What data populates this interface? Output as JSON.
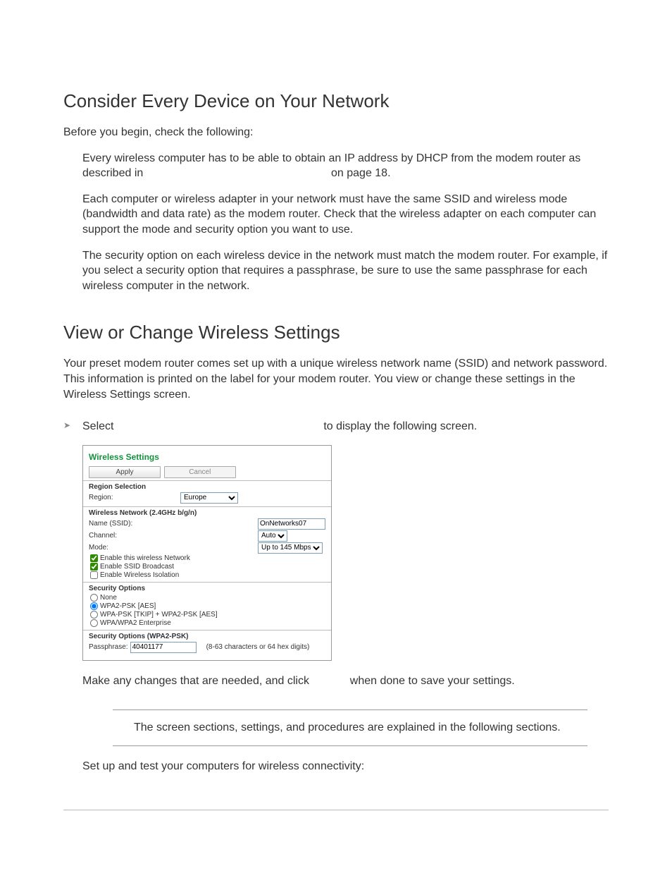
{
  "h1": "Consider Every Device on Your Network",
  "p1": "Before you begin, check the following:",
  "bullet1_a": "Every wireless computer has to be able to obtain an IP address by DHCP from the modem router as described in",
  "bullet1_b": "on page 18.",
  "bullet2": "Each computer or wireless adapter in your network must have the same SSID and wireless mode (bandwidth and data rate) as the modem router. Check that the wireless adapter on each computer can support the mode and security option you want to use.",
  "bullet3": "The security option on each wireless device in the network must match the modem router. For example, if you select a security option that requires a passphrase, be sure to use the same passphrase for each wireless computer in the network.",
  "h2": "View or Change Wireless Settings",
  "p2": "Your preset modem router comes set up with a unique wireless network name (SSID) and network password. This information is printed on the label for your modem router. You view or change these settings in the Wireless Settings screen.",
  "select_a": "Select",
  "select_b": "to display the following screen.",
  "ws": {
    "title": "Wireless Settings",
    "apply": "Apply",
    "cancel": "Cancel",
    "region_sel_hdr": "Region Selection",
    "region_lbl": "Region:",
    "region_val": "Europe",
    "wnet_hdr": "Wireless Network (2.4GHz b/g/n)",
    "ssid_lbl": "Name (SSID):",
    "ssid_val": "OnNetworks07",
    "channel_lbl": "Channel:",
    "channel_val": "Auto",
    "mode_lbl": "Mode:",
    "mode_val": "Up to 145 Mbps",
    "enable_net": "Enable this wireless Network",
    "enable_ssid": "Enable SSID Broadcast",
    "enable_iso": "Enable Wireless Isolation",
    "sec_hdr": "Security Options",
    "sec_none": "None",
    "sec_aes": "WPA2-PSK [AES]",
    "sec_mix": "WPA-PSK [TKIP] + WPA2-PSK [AES]",
    "sec_ent": "WPA/WPA2 Enterprise",
    "sec2_hdr": "Security Options (WPA2-PSK)",
    "pass_lbl": "Passphrase:",
    "pass_val": "40401177",
    "pass_hint": "(8-63 characters or 64 hex digits)"
  },
  "after_a": "Make any changes that are needed, and click",
  "after_b": "when done to save your settings.",
  "note": "The screen sections, settings, and procedures are explained in the following sections.",
  "p3": "Set up and test your computers for wireless connectivity:"
}
